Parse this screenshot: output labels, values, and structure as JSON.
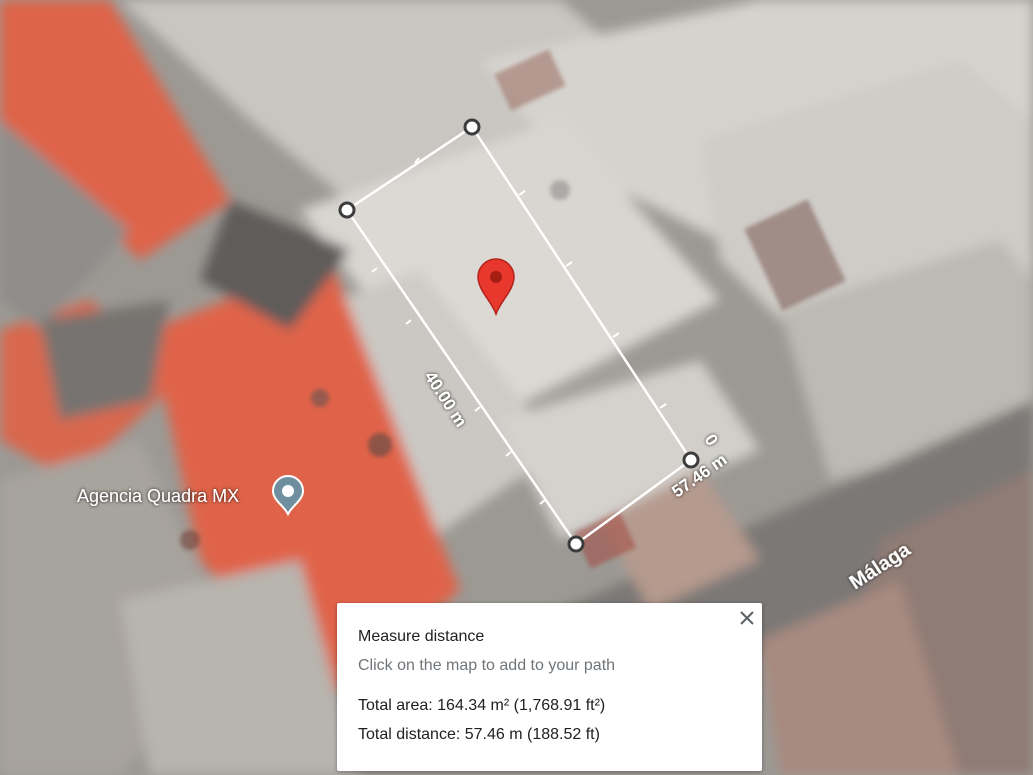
{
  "map": {
    "view": "satellite",
    "place_label": "Agencia Quadra MX",
    "street_label": "Málaga",
    "segment_labels": [
      "40.00 m",
      "57.46 m",
      "0"
    ]
  },
  "measure_panel": {
    "title": "Measure distance",
    "hint": "Click on the map to add to your path",
    "total_area": "Total area: 164.34 m² (1,768.91 ft²)",
    "total_distance": "Total distance: 57.46 m (188.52 ft)"
  },
  "colors": {
    "pin_red": "#e8372c",
    "measure_line": "#ffffff",
    "roof_orange": "#e0634a",
    "place_icon": "#6f8f9f"
  },
  "icons": {
    "close": "close-icon",
    "place": "place-marker-icon",
    "pin": "red-map-pin-icon"
  }
}
